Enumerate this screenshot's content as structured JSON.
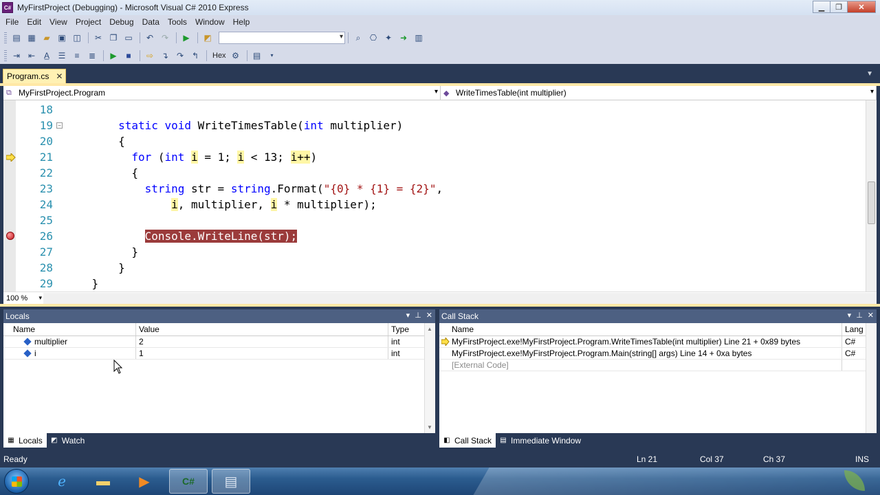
{
  "window": {
    "title": "MyFirstProject (Debugging) - Microsoft Visual C# 2010 Express",
    "app_icon": "C#"
  },
  "menu": [
    "File",
    "Edit",
    "View",
    "Project",
    "Debug",
    "Data",
    "Tools",
    "Window",
    "Help"
  ],
  "toolbar": {
    "hex_label": "Hex",
    "solution_config_value": ""
  },
  "doc_tab": {
    "label": "Program.cs"
  },
  "navbar": {
    "type_combo": "MyFirstProject.Program",
    "member_combo": "WriteTimesTable(int multiplier)"
  },
  "editor": {
    "zoom": "100 %",
    "line_numbers": [
      "18",
      "19",
      "20",
      "21",
      "22",
      "23",
      "24",
      "25",
      "26",
      "27",
      "28",
      "29"
    ],
    "current_line": "21",
    "breakpoint_line": "26"
  },
  "locals": {
    "title": "Locals",
    "columns": [
      "Name",
      "Value",
      "Type"
    ],
    "rows": [
      {
        "name": "multiplier",
        "value": "2",
        "type": "int"
      },
      {
        "name": "i",
        "value": "1",
        "type": "int"
      }
    ],
    "tabs": [
      "Locals",
      "Watch"
    ]
  },
  "callstack": {
    "title": "Call Stack",
    "columns": [
      "Name",
      "Lang"
    ],
    "rows": [
      {
        "name": "MyFirstProject.exe!MyFirstProject.Program.WriteTimesTable(int multiplier) Line 21 + 0x89 bytes",
        "lang": "C#"
      },
      {
        "name": "MyFirstProject.exe!MyFirstProject.Program.Main(string[] args) Line 14 + 0xa bytes",
        "lang": "C#"
      },
      {
        "name": "[External Code]",
        "lang": ""
      }
    ],
    "tabs": [
      "Call Stack",
      "Immediate Window"
    ]
  },
  "status": {
    "state": "Ready",
    "ln": "Ln 21",
    "col": "Col 37",
    "ch": "Ch 37",
    "mode": "INS"
  },
  "colors": {
    "chrome": "#293955",
    "tool_header": "#4d6082",
    "active_tab": "#fff1b3",
    "breakpoint": "#9b3b3b",
    "current_stmt": "#fff7a6",
    "keyword": "#0000ff",
    "string": "#a31515",
    "line_number": "#2b91af"
  },
  "icons": [
    "visual-csharp-icon",
    "start-orb-icon",
    "internet-explorer-icon",
    "explorer-folder-icon",
    "media-player-icon",
    "visual-csharp-taskbar-icon",
    "window-app-icon",
    "leaf-logo-icon"
  ]
}
